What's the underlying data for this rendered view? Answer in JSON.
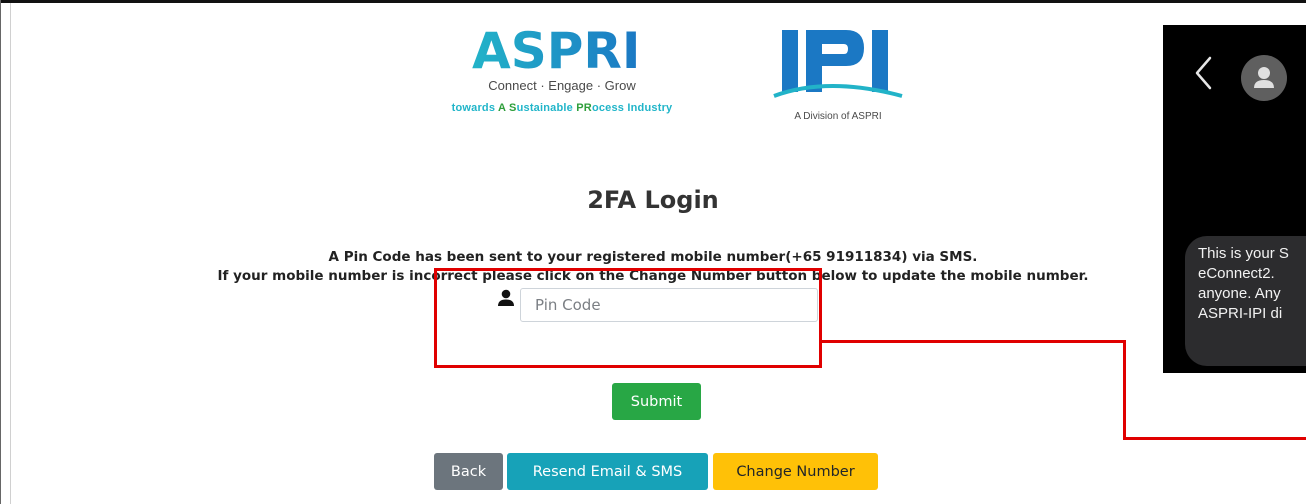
{
  "logos": {
    "aspri": {
      "wordmark": "ASPRI",
      "tagline": "Connect · Engage · Grow",
      "subtitle_parts": [
        "towards ",
        "A",
        " ",
        "S",
        "ustainable ",
        "PR",
        "ocess Industry"
      ]
    },
    "ipi": {
      "wordmark": "IPI",
      "caption": "A Division of ASPRI"
    }
  },
  "page": {
    "title": "2FA Login",
    "message_line1": "A Pin Code has been sent to your registered mobile number(+65 91911834) via SMS.",
    "message_line2": "If your mobile number is incorrect please click on the Change Number button below to update the mobile number."
  },
  "form": {
    "pin_placeholder": "Pin Code",
    "pin_value": "",
    "user_icon": "user-icon"
  },
  "buttons": {
    "submit": "Submit",
    "back": "Back",
    "resend": "Resend Email & SMS",
    "change_number": "Change Number"
  },
  "phone": {
    "sms_lines": [
      "This is your S",
      "eConnect2. ",
      "anyone. Any",
      "ASPRI-IPI di"
    ]
  },
  "colors": {
    "submit": "#28a745",
    "back": "#6c757d",
    "resend": "#17a2b8",
    "change_number": "#ffc107",
    "annotation": "#e00000",
    "aspri_blue": "#1a9fd6",
    "aspri_teal": "#21b5c9",
    "aspri_green": "#2e9e3a"
  }
}
